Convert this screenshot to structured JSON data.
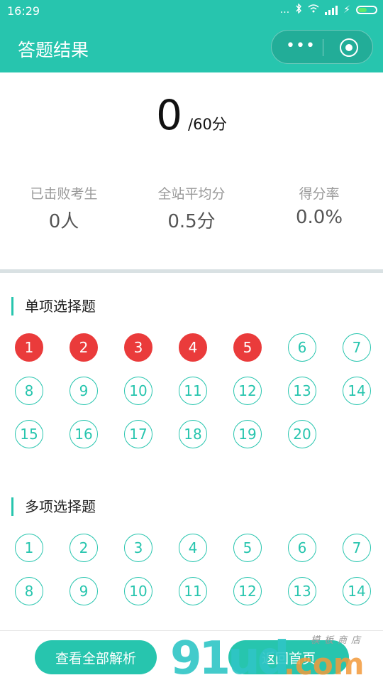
{
  "status_bar": {
    "time": "16:29",
    "dots": "...",
    "bluetooth": "bluetooth-icon",
    "wifi": "wifi-icon",
    "charge": "⚡"
  },
  "header": {
    "title": "答题结果",
    "menu_dots": "•••",
    "bg_color": "#27c5ae"
  },
  "score": {
    "value": "0",
    "total": "/60分"
  },
  "stats": [
    {
      "label": "已击败考生",
      "value": "0人"
    },
    {
      "label": "全站平均分",
      "value": "0.5分"
    },
    {
      "label": "得分率",
      "value": "0.0%"
    }
  ],
  "sections": [
    {
      "title": "单项选择题",
      "questions": [
        {
          "n": "1",
          "wrong": true
        },
        {
          "n": "2",
          "wrong": true
        },
        {
          "n": "3",
          "wrong": true
        },
        {
          "n": "4",
          "wrong": true
        },
        {
          "n": "5",
          "wrong": true
        },
        {
          "n": "6",
          "wrong": false
        },
        {
          "n": "7",
          "wrong": false
        },
        {
          "n": "8",
          "wrong": false
        },
        {
          "n": "9",
          "wrong": false
        },
        {
          "n": "10",
          "wrong": false
        },
        {
          "n": "11",
          "wrong": false
        },
        {
          "n": "12",
          "wrong": false
        },
        {
          "n": "13",
          "wrong": false
        },
        {
          "n": "14",
          "wrong": false
        },
        {
          "n": "15",
          "wrong": false
        },
        {
          "n": "16",
          "wrong": false
        },
        {
          "n": "17",
          "wrong": false
        },
        {
          "n": "18",
          "wrong": false
        },
        {
          "n": "19",
          "wrong": false
        },
        {
          "n": "20",
          "wrong": false
        }
      ]
    },
    {
      "title": "多项选择题",
      "questions": [
        {
          "n": "1",
          "wrong": false
        },
        {
          "n": "2",
          "wrong": false
        },
        {
          "n": "3",
          "wrong": false
        },
        {
          "n": "4",
          "wrong": false
        },
        {
          "n": "5",
          "wrong": false
        },
        {
          "n": "6",
          "wrong": false
        },
        {
          "n": "7",
          "wrong": false
        },
        {
          "n": "8",
          "wrong": false
        },
        {
          "n": "9",
          "wrong": false
        },
        {
          "n": "10",
          "wrong": false
        },
        {
          "n": "11",
          "wrong": false
        },
        {
          "n": "12",
          "wrong": false
        },
        {
          "n": "13",
          "wrong": false
        },
        {
          "n": "14",
          "wrong": false
        }
      ]
    }
  ],
  "buttons": {
    "view_all": "查看全部解析",
    "home": "返回首页"
  },
  "watermark": {
    "brand": "91ud",
    "domain": ".com",
    "tagline": "模板商店"
  },
  "colors": {
    "accent": "#27c5ae",
    "wrong": "#ea3b3b"
  }
}
